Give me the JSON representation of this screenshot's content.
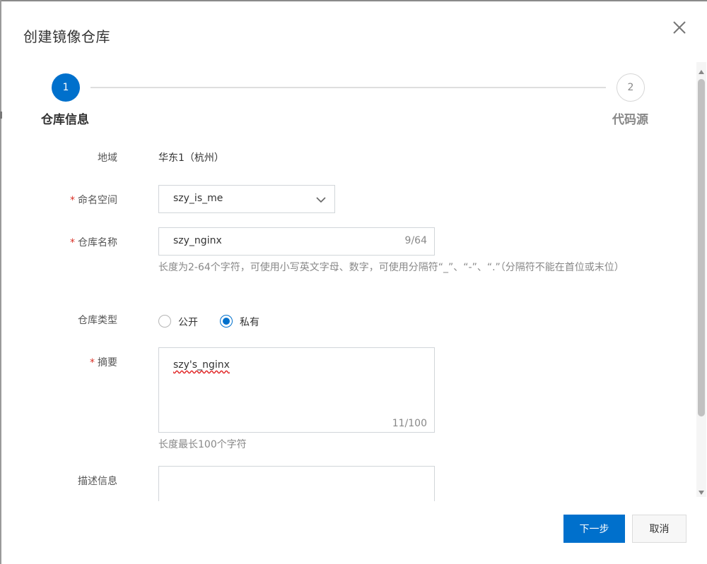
{
  "dialog": {
    "title": "创建镜像仓库",
    "close_icon": "close-icon"
  },
  "steps": [
    {
      "number": "1",
      "label": "仓库信息",
      "state": "active"
    },
    {
      "number": "2",
      "label": "代码源",
      "state": "inactive"
    }
  ],
  "form": {
    "region": {
      "label": "地域",
      "value": "华东1（杭州）"
    },
    "namespace": {
      "label": "命名空间",
      "required": "*",
      "value": "szy_is_me",
      "icon": "chevron-down-icon"
    },
    "repo_name": {
      "label": "仓库名称",
      "required": "*",
      "value": "szy_nginx",
      "counter": "9/64",
      "hint": "长度为2-64个字符，可使用小写英文字母、数字，可使用分隔符“_”、“-”、“.”（分隔符不能在首位或末位）"
    },
    "repo_type": {
      "label": "仓库类型",
      "options": [
        {
          "label": "公开",
          "checked": false
        },
        {
          "label": "私有",
          "checked": true
        }
      ]
    },
    "summary": {
      "label": "摘要",
      "required": "*",
      "value": "szy's_nginx",
      "counter": "11/100",
      "hint": "长度最长100个字符"
    },
    "description": {
      "label": "描述信息",
      "value": ""
    }
  },
  "footer": {
    "next_label": "下一步",
    "cancel_label": "取消"
  },
  "colors": {
    "primary": "#0070cc",
    "required": "#d93026",
    "hint": "#888888"
  }
}
